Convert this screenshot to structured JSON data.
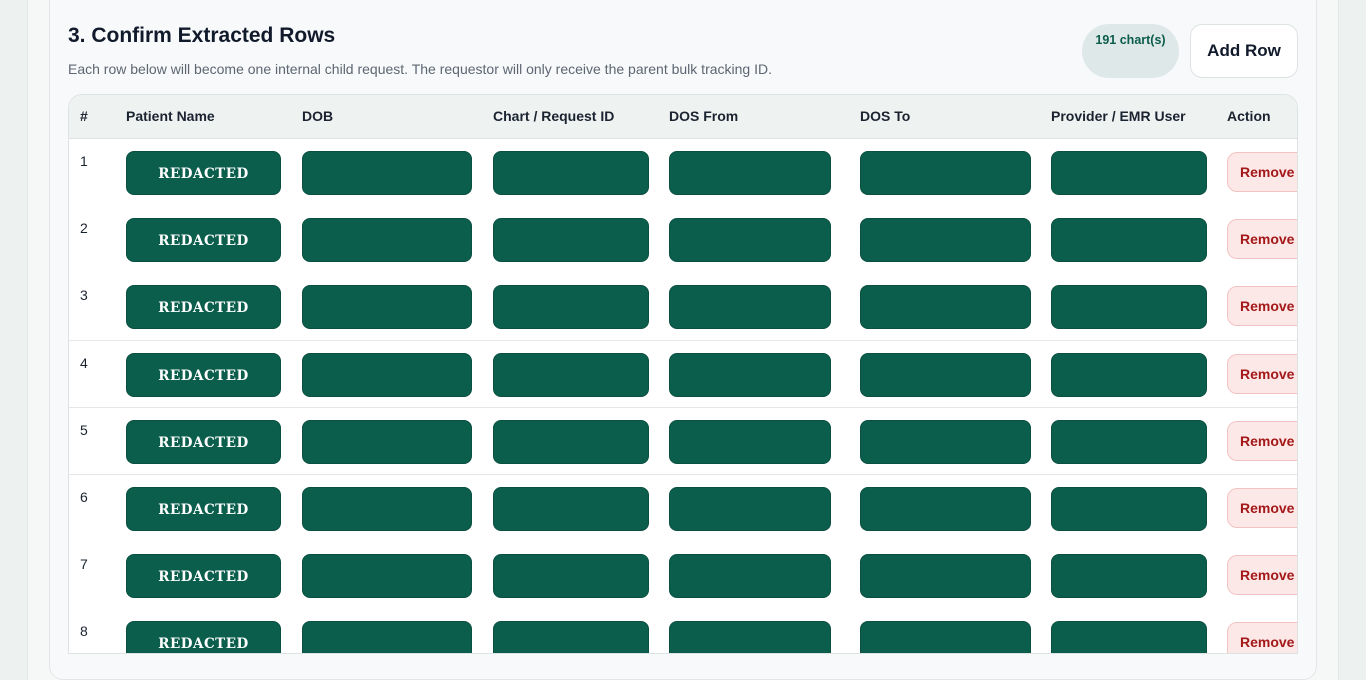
{
  "section": {
    "title": "3. Confirm Extracted Rows",
    "subtitle": "Each row below will become one internal child request. The requestor will only receive the parent bulk tracking ID.",
    "count_badge": "191 chart(s)",
    "add_row_label": "Add Row"
  },
  "table": {
    "columns": [
      "#",
      "Patient Name",
      "DOB",
      "Chart / Request ID",
      "DOS From",
      "DOS To",
      "Provider / EMR User",
      "Action"
    ],
    "rows": [
      {
        "num": "1",
        "patient_name": "REDACTED",
        "action": "Remove"
      },
      {
        "num": "2",
        "patient_name": "REDACTED",
        "action": "Remove"
      },
      {
        "num": "3",
        "patient_name": "REDACTED",
        "action": "Remove"
      },
      {
        "num": "4",
        "patient_name": "REDACTED",
        "action": "Remove"
      },
      {
        "num": "5",
        "patient_name": "REDACTED",
        "action": "Remove"
      },
      {
        "num": "6",
        "patient_name": "REDACTED",
        "action": "Remove"
      },
      {
        "num": "7",
        "patient_name": "REDACTED",
        "action": "Remove"
      },
      {
        "num": "8",
        "patient_name": "REDACTED",
        "action": "Remove"
      }
    ]
  },
  "colors": {
    "accent": "#0b5e4c",
    "remove_bg": "#fde8e8",
    "remove_text": "#a31818"
  }
}
